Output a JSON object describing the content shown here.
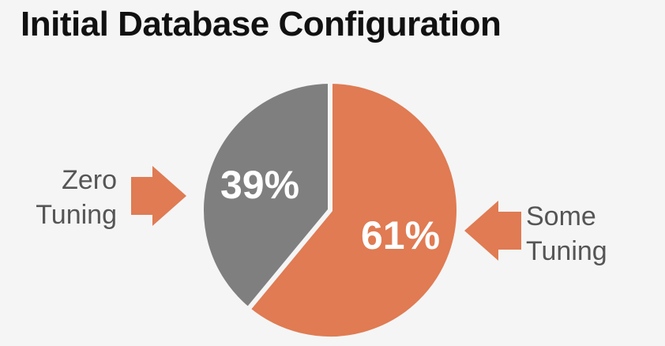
{
  "chart_data": {
    "type": "pie",
    "title": "Initial Database Configuration",
    "slices": [
      {
        "name": "Some Tuning",
        "label_lines": [
          "Some",
          "Tuning"
        ],
        "value": 61,
        "value_label": "61%",
        "color": "#e07b53"
      },
      {
        "name": "Zero Tuning",
        "label_lines": [
          "Zero",
          "Tuning"
        ],
        "value": 39,
        "value_label": "39%",
        "color": "#7f7f7f"
      }
    ]
  },
  "colors": {
    "background": "#f5f5f5",
    "title": "#111111",
    "annotation_text": "#555555",
    "arrow": "#e07b53",
    "value_label": "#ffffff"
  }
}
